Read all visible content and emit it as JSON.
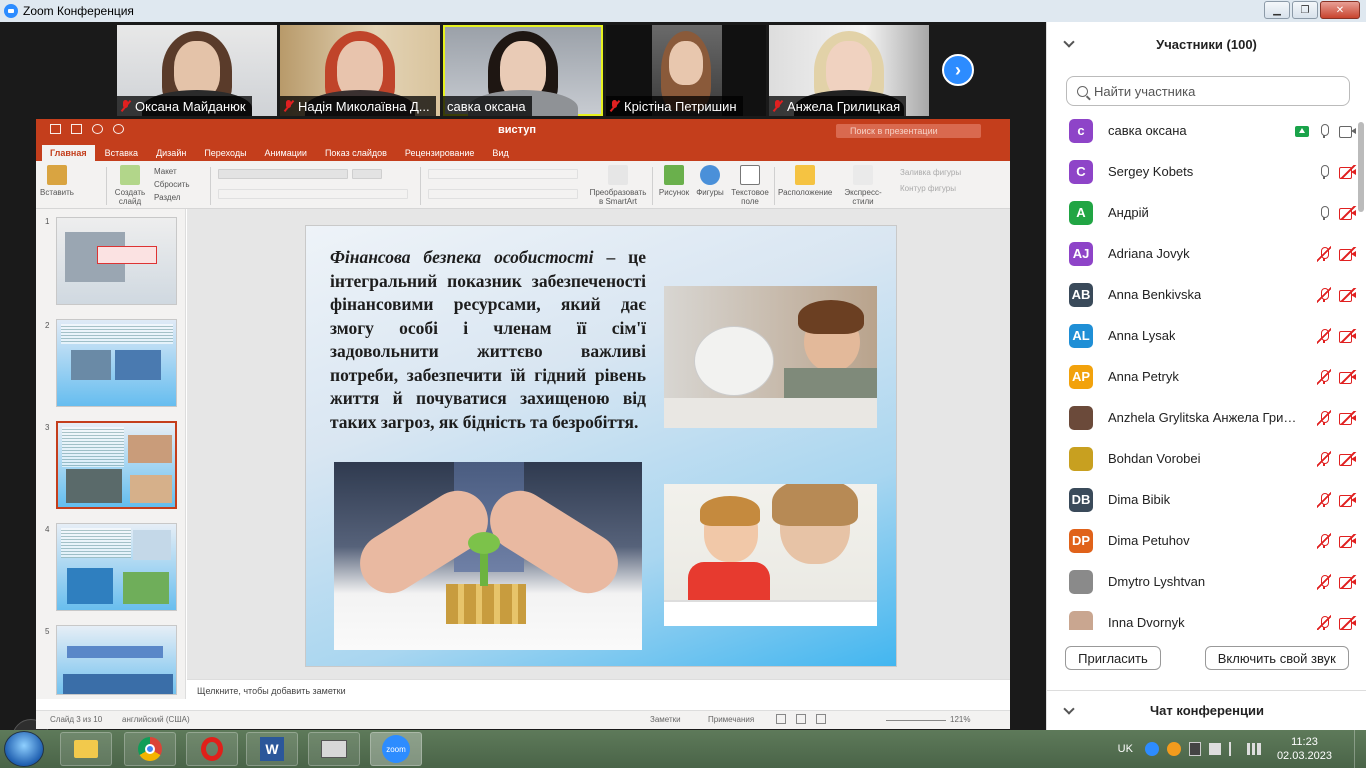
{
  "window": {
    "title": "Zoom Конференция",
    "controls": {
      "minimize": "▁",
      "maximize": "❐",
      "close": "✕"
    }
  },
  "video_tiles": [
    {
      "name": "Оксана Майданюк",
      "muted": true
    },
    {
      "name": "Надія Миколаївна Д...",
      "muted": true
    },
    {
      "name": "савка оксана",
      "muted": false,
      "active": true
    },
    {
      "name": "Крістіна Петришин",
      "muted": true
    },
    {
      "name": "Анжела Грилицкая",
      "muted": true
    }
  ],
  "video_nav": {
    "next": "›"
  },
  "powerpoint": {
    "doc_title": "виступ",
    "search_placeholder": "Поиск в презентации",
    "tabs": [
      "Главная",
      "Вставка",
      "Дизайн",
      "Переходы",
      "Анимации",
      "Показ слайдов",
      "Рецензирование",
      "Вид"
    ],
    "ribbon": {
      "paste": "Вставить",
      "create_slide": "Создать слайд",
      "layout": "Макет",
      "reset": "Сбросить",
      "section": "Раздел",
      "convert_smartart": "Преобразовать в SmartArt",
      "picture": "Рисунок",
      "shapes": "Фигуры",
      "textbox": "Текстовое поле",
      "arrange": "Расположение",
      "quick_styles": "Экспресс-стили",
      "fill": "Заливка фигуры",
      "outline": "Контур фигуры"
    },
    "thumbnail_numbers": [
      "1",
      "2",
      "3",
      "4",
      "5"
    ],
    "selected_slide": 3,
    "slide": {
      "text_lead": "Фінансова безпека особистості",
      "text_body": "– це інтегральний показник забезпеченості фінансовими ресурсами, який дає змогу особі і членам її сім'ї задовольнити життєво важливі потреби, забезпечити їй гідний рівень життя й почуватися захищеною від таких загроз, як бідність та безробіття."
    },
    "notes_placeholder": "Щелкните, чтобы добавить заметки",
    "status": {
      "slide_of": "Слайд 3 из 10",
      "language": "английский (США)",
      "notes": "Заметки",
      "comments": "Примечания",
      "zoom": "121%"
    }
  },
  "participants_panel": {
    "title": "Участники (100)",
    "search_placeholder": "Найти участника",
    "participants": [
      {
        "initials": "с",
        "name": "савка оксана",
        "color": "#8e44c8",
        "mic": "on",
        "cam": "on",
        "sharing": true
      },
      {
        "initials": "C",
        "name": "Sergey Kobets",
        "color": "#8e44c8",
        "mic": "on",
        "cam": "off"
      },
      {
        "initials": "A",
        "name": "Андрій",
        "color": "#21a544",
        "mic": "on",
        "cam": "off"
      },
      {
        "initials": "AJ",
        "name": "Adriana Jovyk",
        "color": "#8e44c8",
        "mic": "muted",
        "cam": "off"
      },
      {
        "initials": "AB",
        "name": "Anna Benkivska",
        "color": "#3a4a5a",
        "mic": "muted",
        "cam": "off"
      },
      {
        "initials": "AL",
        "name": "Anna Lysak",
        "color": "#1f8fd6",
        "mic": "muted",
        "cam": "off"
      },
      {
        "initials": "AP",
        "name": "Anna Petryk",
        "color": "#f2a20c",
        "mic": "muted",
        "cam": "off"
      },
      {
        "initials": "",
        "name": "Anzhela Grylitska Анжела Грилі...",
        "color": "#6b4a3a",
        "mic": "muted",
        "cam": "off"
      },
      {
        "initials": "",
        "name": "Bohdan Vorobei",
        "color": "#c8a020",
        "mic": "muted",
        "cam": "off"
      },
      {
        "initials": "DB",
        "name": "Dima Bibik",
        "color": "#3a4a5a",
        "mic": "muted",
        "cam": "off"
      },
      {
        "initials": "DP",
        "name": "Dima Petuhov",
        "color": "#e0621a",
        "mic": "muted",
        "cam": "off"
      },
      {
        "initials": "",
        "name": "Dmytro Lyshtvan",
        "color": "#8a8a8a",
        "mic": "muted",
        "cam": "off"
      },
      {
        "initials": "",
        "name": "Inna Dvornyk",
        "color": "#c9a690",
        "mic": "muted",
        "cam": "off"
      }
    ],
    "invite_button": "Пригласить",
    "unmute_button": "Включить свой звук"
  },
  "chat_panel": {
    "title": "Чат конференции"
  },
  "taskbar": {
    "language": "UK",
    "time": "11:23",
    "date": "02.03.2023",
    "zoom_label": "zoom"
  }
}
